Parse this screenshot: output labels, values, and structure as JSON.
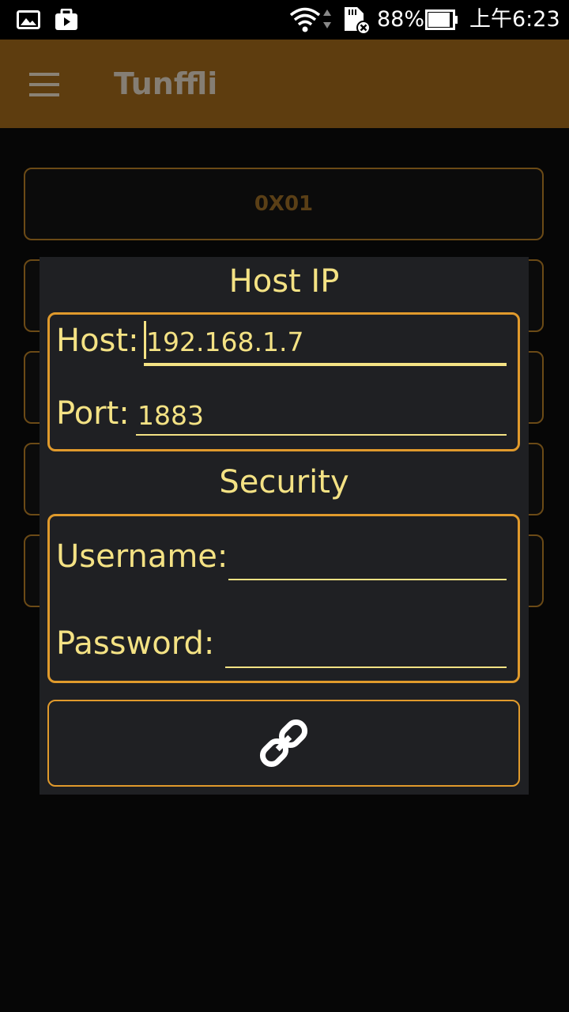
{
  "status_bar": {
    "battery": "88%",
    "time": "上午6:23",
    "icons": [
      "gallery-icon",
      "play-store-icon",
      "wifi-icon",
      "sd-card-error-icon",
      "battery-icon"
    ]
  },
  "app_bar": {
    "title": "Tunffli",
    "menu_icon": "hamburger-menu-icon"
  },
  "background": {
    "first_button_label": "0X01"
  },
  "dialog": {
    "host_section_title": "Host IP",
    "host_label": "Host:",
    "host_value": "192.168.1.7",
    "port_label": "Port:",
    "port_value": "1883",
    "security_section_title": "Security",
    "username_label": "Username:",
    "username_value": "",
    "password_label": "Password:",
    "password_value": "",
    "connect_icon": "link-icon"
  },
  "colors": {
    "appbar": "#5e3d0f",
    "accent_border": "#e09a2c",
    "text_yellow": "#f4e284",
    "dialog_bg": "#1f2023"
  }
}
